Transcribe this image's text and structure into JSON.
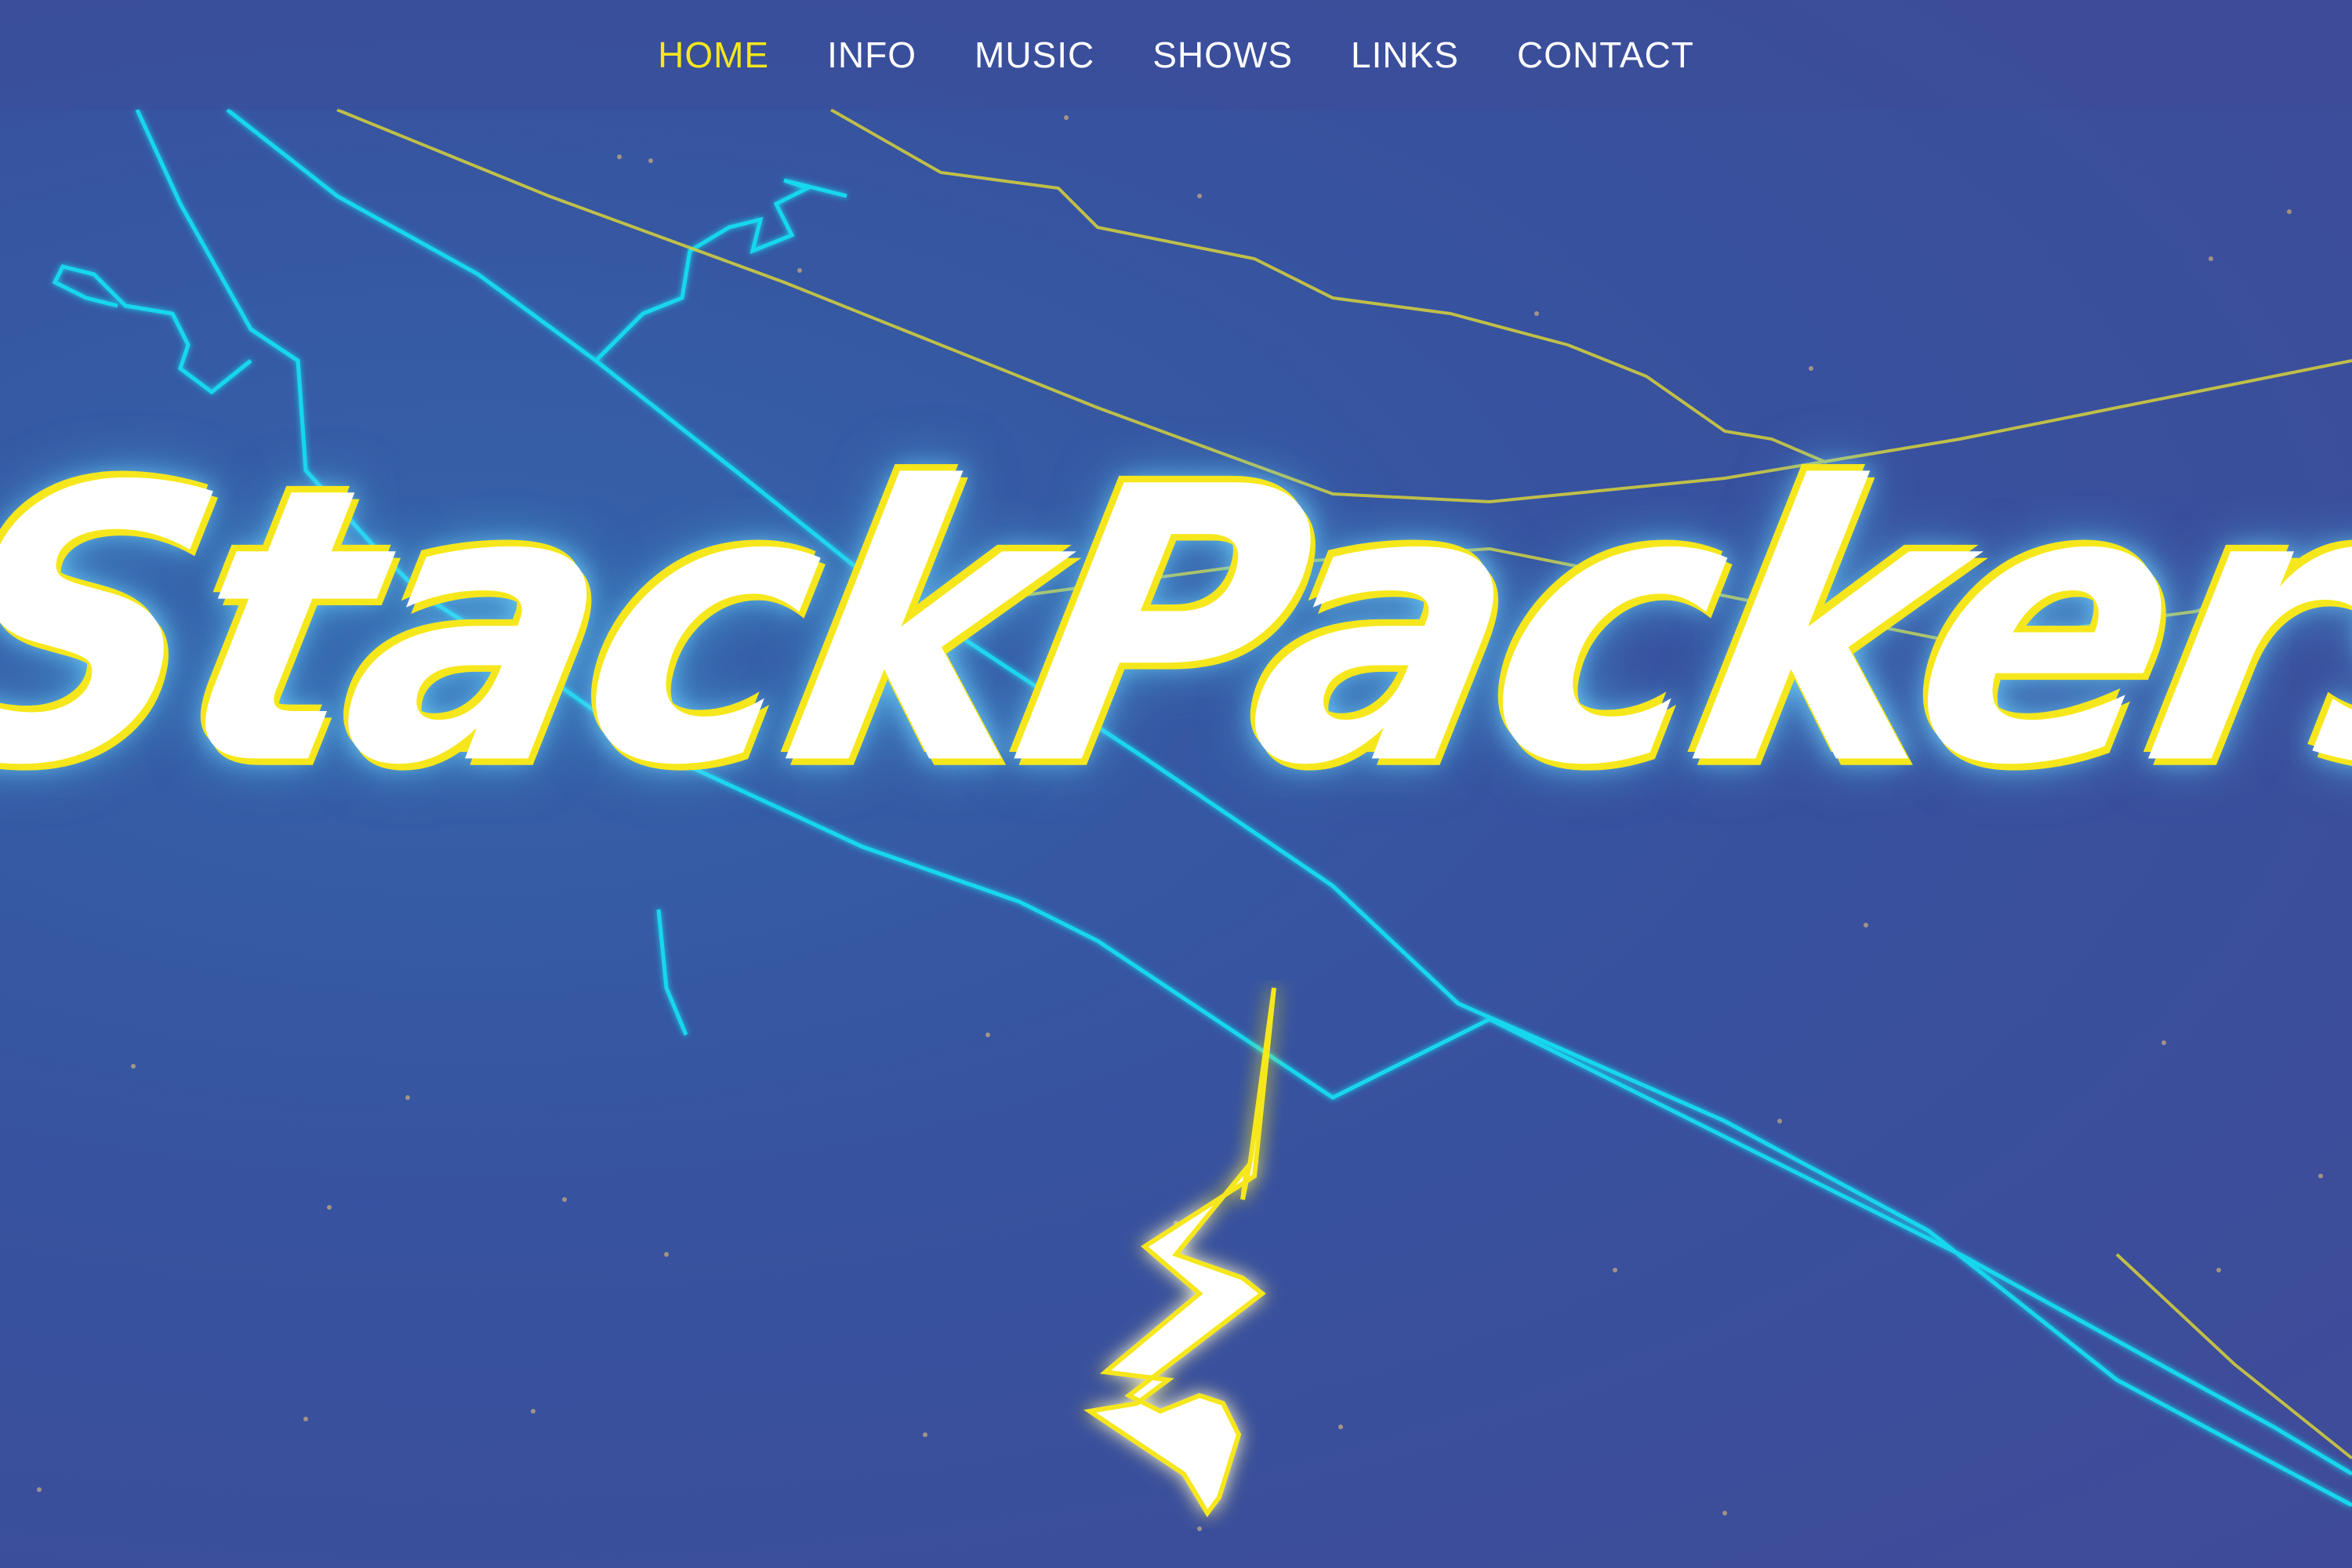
{
  "nav": {
    "items": [
      {
        "label": "HOME",
        "active": true
      },
      {
        "label": "INFO",
        "active": false
      },
      {
        "label": "MUSIC",
        "active": false
      },
      {
        "label": "SHOWS",
        "active": false
      },
      {
        "label": "LINKS",
        "active": false
      },
      {
        "label": "CONTACT",
        "active": false
      }
    ]
  },
  "hero": {
    "logo_text": "StackPackers",
    "icons": [
      "lightning-bolt-icon"
    ]
  },
  "colors": {
    "background": "#37529f",
    "accent_yellow": "#f6e71c",
    "nav_text": "#ffffff",
    "line_cyan": "#19d7ee",
    "line_yellow": "#d8d23a",
    "logo_fill": "#ffffff"
  }
}
